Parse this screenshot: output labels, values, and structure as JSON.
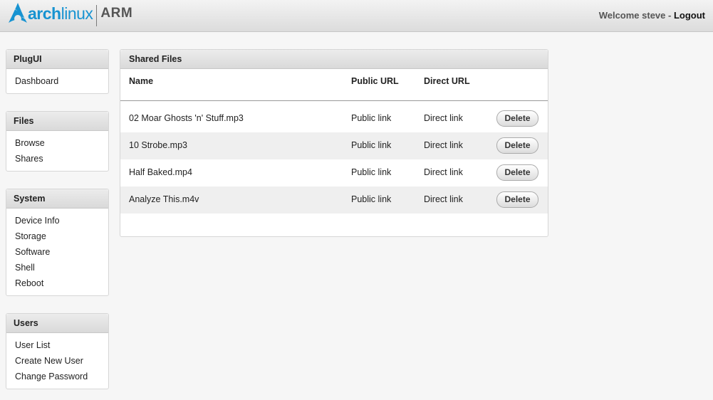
{
  "header": {
    "logo": {
      "arch_bold": "arch",
      "arch_light": "linux",
      "arm": "ARM",
      "brand_color": "#1793d1"
    },
    "welcome_text": "Welcome steve -",
    "logout_label": "Logout"
  },
  "sidebar": {
    "plugui": {
      "title": "PlugUI",
      "items": [
        "Dashboard"
      ]
    },
    "files": {
      "title": "Files",
      "items": [
        "Browse",
        "Shares"
      ]
    },
    "system": {
      "title": "System",
      "items": [
        "Device Info",
        "Storage",
        "Software",
        "Shell",
        "Reboot"
      ]
    },
    "users": {
      "title": "Users",
      "items": [
        "User List",
        "Create New User",
        "Change Password"
      ]
    }
  },
  "shared_files": {
    "title": "Shared Files",
    "columns": {
      "name": "Name",
      "public_url": "Public URL",
      "direct_url": "Direct URL"
    },
    "rows": [
      {
        "name": "02 Moar Ghosts 'n' Stuff.mp3",
        "public": "Public link",
        "direct": "Direct link",
        "action": "Delete"
      },
      {
        "name": "10 Strobe.mp3",
        "public": "Public link",
        "direct": "Direct link",
        "action": "Delete"
      },
      {
        "name": "Half Baked.mp4",
        "public": "Public link",
        "direct": "Direct link",
        "action": "Delete"
      },
      {
        "name": "Analyze This.m4v",
        "public": "Public link",
        "direct": "Direct link",
        "action": "Delete"
      }
    ]
  }
}
